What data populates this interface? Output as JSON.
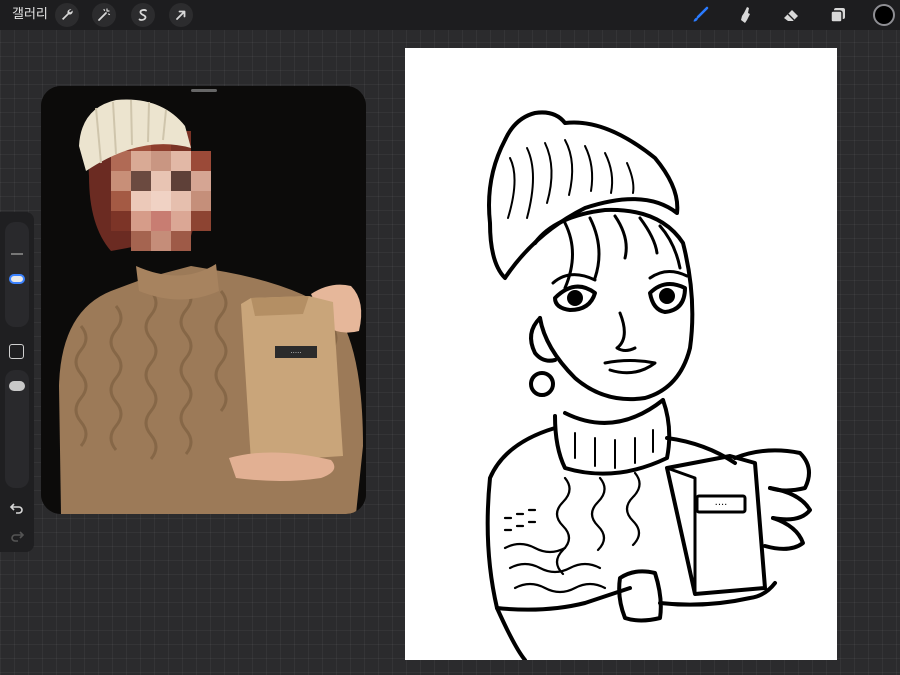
{
  "topbar": {
    "gallery_label": "갤러리",
    "left_tools": [
      {
        "name": "actions",
        "icon": "wrench-icon"
      },
      {
        "name": "adjustments",
        "icon": "magic-wand-icon"
      },
      {
        "name": "selection",
        "icon": "selection-s-icon"
      },
      {
        "name": "transform",
        "icon": "arrow-cursor-icon"
      }
    ],
    "right_tools": [
      {
        "name": "brush",
        "icon": "brush-icon",
        "active": true
      },
      {
        "name": "smudge",
        "icon": "smudge-icon"
      },
      {
        "name": "eraser",
        "icon": "eraser-icon"
      },
      {
        "name": "layers",
        "icon": "layers-icon"
      }
    ],
    "current_color": "#000000",
    "accent_color": "#2a7bff"
  },
  "sidebar": {
    "brush_size_level": 0.45,
    "opacity_level": 0.9,
    "icons": [
      "modify-square-icon",
      "undo-icon",
      "redo-icon"
    ]
  },
  "reference": {
    "bag_label_text": "·····"
  },
  "canvas": {
    "background": "#ffffff",
    "stroke_color": "#000000",
    "bag_label_text": "····"
  }
}
